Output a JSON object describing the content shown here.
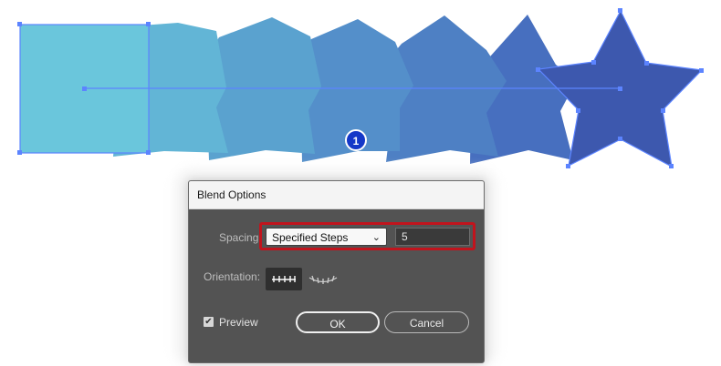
{
  "canvas": {
    "colors": {
      "square": "#6ac6dc",
      "shape2": "#62b5d6",
      "shape3": "#5aa2cf",
      "shape4": "#548fca",
      "shape5": "#4e80c4",
      "shape6": "#476fbf",
      "star": "#3d58ae",
      "selection": "#5c84ff",
      "badge": "#1538c8"
    },
    "badge_label": "1"
  },
  "dialog": {
    "title": "Blend Options",
    "spacing_label": "Spacing",
    "spacing_value": "Specified Steps",
    "steps_value": "5",
    "orientation_label": "Orientation:",
    "preview_label": "Preview",
    "preview_checked": true,
    "ok_label": "OK",
    "cancel_label": "Cancel",
    "highlight_color": "#c1141d"
  }
}
